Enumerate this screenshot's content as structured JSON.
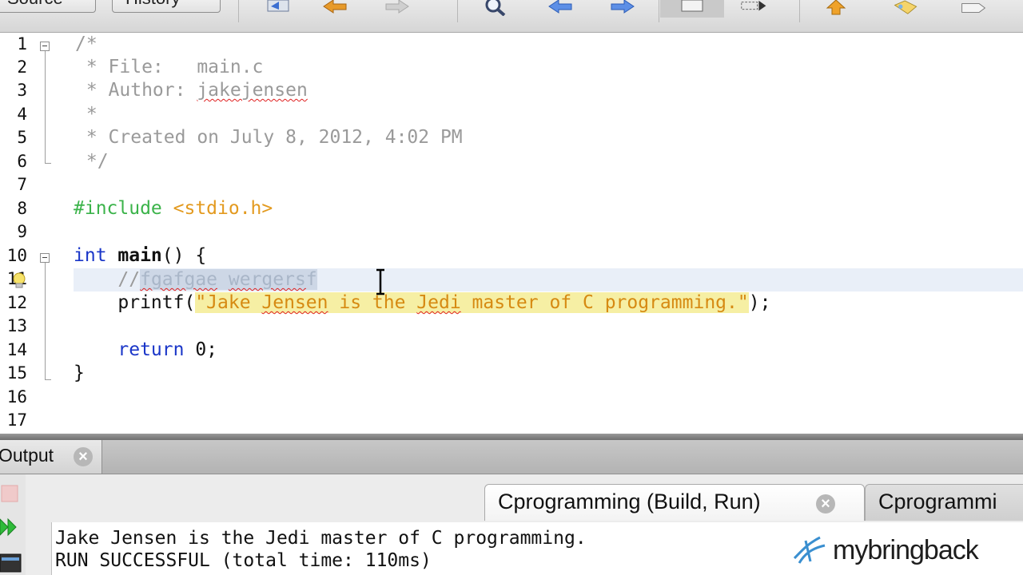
{
  "toolbar": {
    "tabs": [
      {
        "label": "Source"
      },
      {
        "label": "History"
      }
    ],
    "icons": [
      "back-to-last-edit-icon",
      "back-icon",
      "forward-icon",
      "find-icon",
      "find-previous-icon",
      "find-next-icon",
      "toggle-highlight-icon",
      "selection-icon",
      "shift-line-up-icon",
      "bookmark-icon",
      "macro-icon"
    ]
  },
  "editor": {
    "line_numbers": [
      "1",
      "2",
      "3",
      "4",
      "5",
      "6",
      "7",
      "8",
      "9",
      "10",
      "11",
      "12",
      "13",
      "14",
      "15",
      "16",
      "17"
    ],
    "code": {
      "l1": "/*",
      "l2": " * File:   main.c",
      "l3_prefix": " * Author: ",
      "l3_author": "jakejensen",
      "l4": " *",
      "l5": " * Created on July 8, 2012, 4:02 PM",
      "l6": " */",
      "l8_directive": "#include",
      "l8_header": " <stdio.h>",
      "l10_kw": "int",
      "l10_fn": " main",
      "l10_rest": "() {",
      "l11_indent": "    ",
      "l11_slashes": "//",
      "l11_w1": "fgafgae",
      "l11_space": " ",
      "l11_w2": "wergers",
      "l11_tail": "f",
      "l12_indent": "    ",
      "l12_call": "printf(",
      "l12_str_open": "\"Jake ",
      "l12_w1": "Jensen",
      "l12_mid": " is the ",
      "l12_w2": "Jedi",
      "l12_str_end": " master of C programming.\"",
      "l12_close": ");",
      "l14_indent": "    ",
      "l14_kw": "return",
      "l14_rest": " 0;",
      "l15": "}"
    }
  },
  "output": {
    "tab_label": "Output",
    "run_tabs": [
      {
        "label": "Cprogramming (Build, Run)"
      },
      {
        "label": "Cprogrammi"
      }
    ],
    "console_lines": [
      "Jake Jensen is the Jedi master of C programming.",
      "RUN SUCCESSFUL (total time: 110ms)"
    ]
  },
  "watermark": {
    "text": "mybringback"
  },
  "colors": {
    "keyword": "#1a36c8",
    "preprocessor": "#3bb34a",
    "include": "#e39a1f",
    "string": "#d68a12",
    "comment": "#9a9a9a",
    "string_highlight": "#f6efa4"
  }
}
